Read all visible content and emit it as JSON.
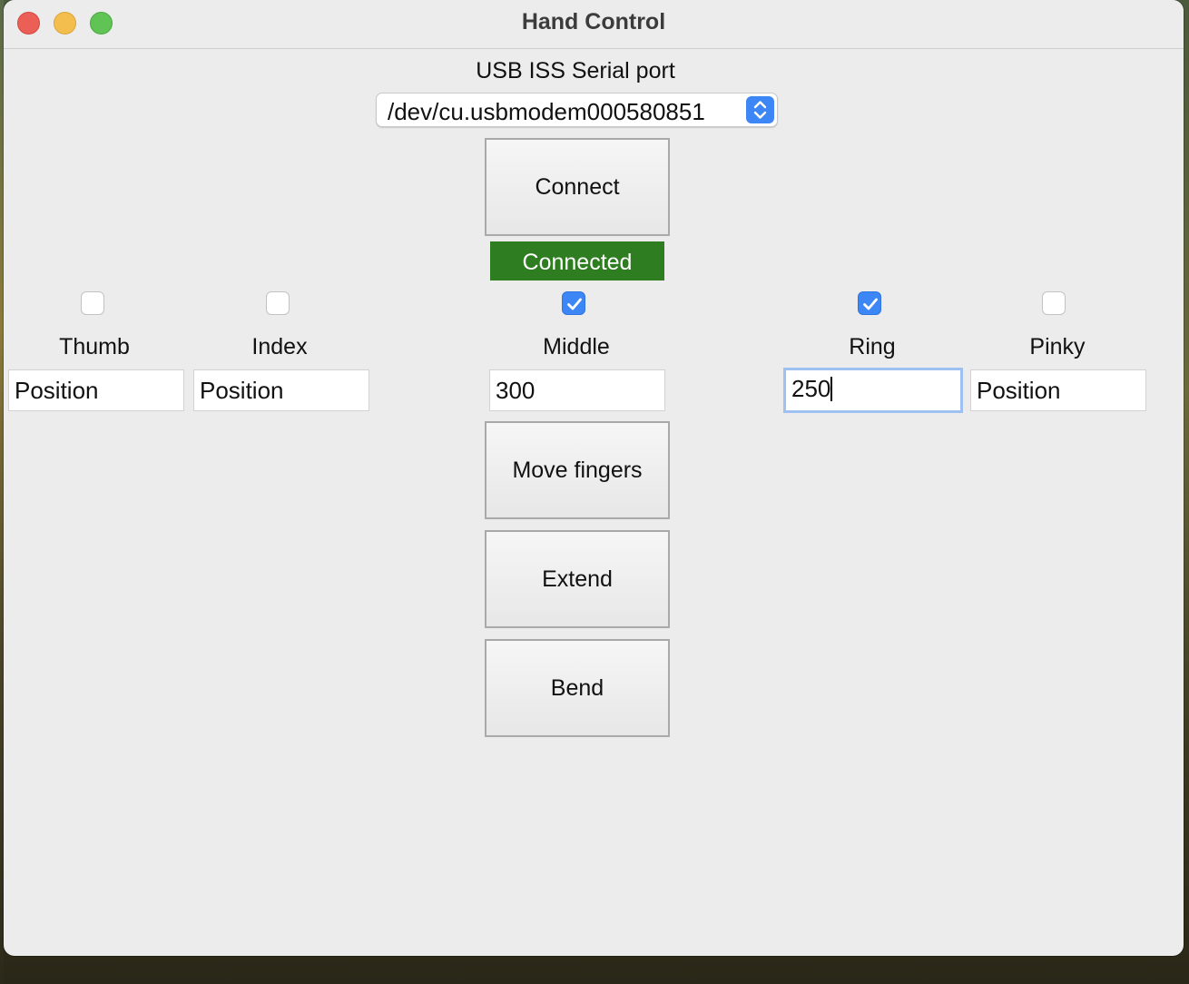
{
  "window": {
    "title": "Hand Control"
  },
  "serial": {
    "label": "USB ISS Serial port",
    "selected_port": "/dev/cu.usbmodem000580851"
  },
  "buttons": {
    "connect": "Connect",
    "move": "Move fingers",
    "extend": "Extend",
    "bend": "Bend"
  },
  "status": {
    "text": "Connected",
    "color": "#2e7d21"
  },
  "fingers": [
    {
      "label": "Thumb",
      "checked": false,
      "value": "",
      "placeholder": "Position"
    },
    {
      "label": "Index",
      "checked": false,
      "value": "",
      "placeholder": "Position"
    },
    {
      "label": "Middle",
      "checked": true,
      "value": "300",
      "placeholder": "Position"
    },
    {
      "label": "Ring",
      "checked": true,
      "value": "250",
      "placeholder": "Position"
    },
    {
      "label": "Pinky",
      "checked": false,
      "value": "",
      "placeholder": "Position"
    }
  ],
  "colors": {
    "accent": "#3d86f6",
    "window_bg": "#ececec"
  }
}
